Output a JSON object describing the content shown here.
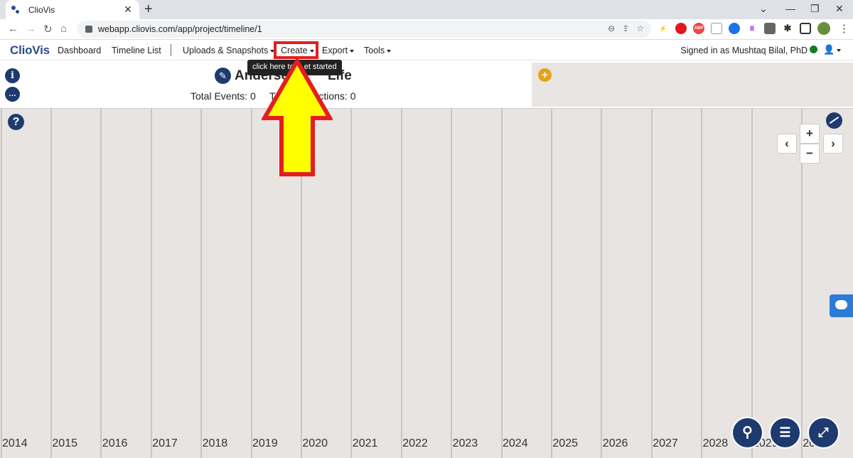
{
  "browser": {
    "tab_title": "ClioVis",
    "new_tab": "+",
    "url": "webapp.cliovis.com/app/project/timeline/1"
  },
  "navbar": {
    "brand": "ClioVis",
    "items": [
      {
        "label": "Dashboard",
        "dropdown": false
      },
      {
        "label": "Timeline List",
        "dropdown": false
      },
      {
        "label": "Uploads & Snapshots",
        "dropdown": true
      },
      {
        "label": "Create",
        "dropdown": true
      },
      {
        "label": "Export",
        "dropdown": true
      },
      {
        "label": "Tools",
        "dropdown": true
      }
    ],
    "signed_in": "Signed in as Mushtaq Bilal, PhD"
  },
  "header": {
    "title": "Andersen's Life",
    "title_visible": "Anderse",
    "title_visible_end": "Life",
    "total_events": "Total Events: 0",
    "total_connections_start": "T",
    "total_connections_end": "ections: 0",
    "tooltip": "click here to get started",
    "tooltip_visible_start": "click here to",
    "tooltip_visible_end": "et started"
  },
  "timeline": {
    "years": [
      "2014",
      "2015",
      "2016",
      "2017",
      "2018",
      "2019",
      "2020",
      "2021",
      "2022",
      "2023",
      "2024",
      "2025",
      "2026",
      "2027",
      "2028",
      "2029",
      "203"
    ],
    "zoom_in": "+",
    "zoom_out": "−",
    "prev": "‹",
    "next": "›"
  },
  "colors": {
    "brand": "#2a4c8a",
    "highlight": "#e41e1e",
    "arrow_fill": "#ffff00",
    "timeline_bg": "#e8e4e2",
    "icon_dark": "#1e3a6e"
  }
}
